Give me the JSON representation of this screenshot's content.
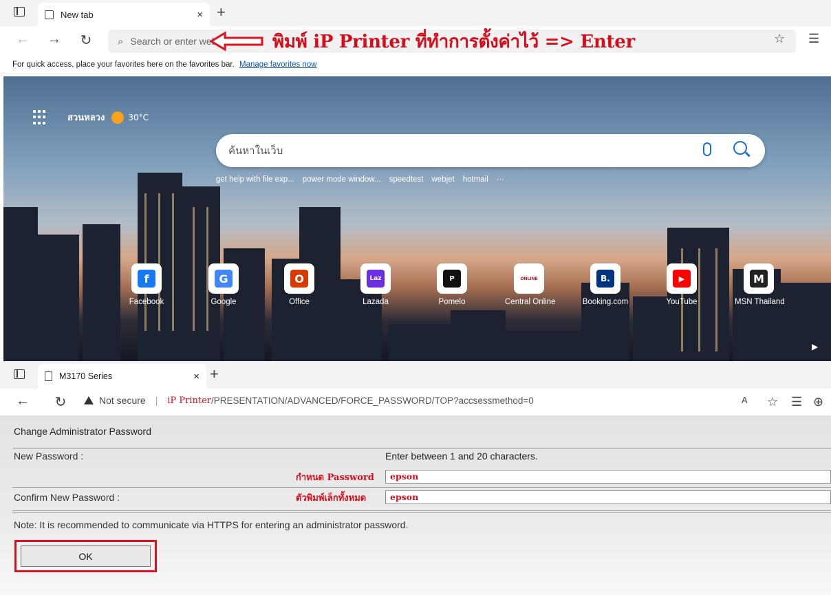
{
  "top_browser": {
    "tab_title": "New tab",
    "tab_close": "×",
    "new_tab": "+",
    "address_placeholder": "Search or enter web address",
    "annotation": "พิมพ์ iP Printer ที่ทำการตั้งค่าไว้ => Enter",
    "favorites_bar_text": "For quick access, place your favorites here on the favorites bar.",
    "favorites_bar_link": "Manage favorites now",
    "weather_location": "สวนหลวง",
    "weather_temp": "30°C",
    "web_search_placeholder": "ค้นหาในเว็บ",
    "suggestions": [
      "get help with file exp...",
      "power mode window...",
      "speedtest",
      "webjet",
      "hotmail",
      "···"
    ],
    "tiles": [
      {
        "label": "Facebook",
        "glyph": "f",
        "color": "#1877f2"
      },
      {
        "label": "Google",
        "glyph": "G",
        "color": "#4285f4"
      },
      {
        "label": "Office",
        "glyph": "O",
        "color": "#d83b01"
      },
      {
        "label": "Lazada",
        "glyph": "Laz",
        "color": "#6a2fe0"
      },
      {
        "label": "Pomelo",
        "glyph": "P",
        "color": "#111111"
      },
      {
        "label": "Central Online",
        "glyph": "ONLINE",
        "color": "#c8102e"
      },
      {
        "label": "Booking.com",
        "glyph": "B.",
        "color": "#003580"
      },
      {
        "label": "YouTube",
        "glyph": "▶",
        "color": "#ff0000"
      },
      {
        "label": "MSN Thailand",
        "glyph": "M",
        "color": "#222222"
      }
    ]
  },
  "bottom_browser": {
    "tab_title": "M3170 Series",
    "tab_close": "×",
    "new_tab": "+",
    "not_secure": "Not secure",
    "url_host": "iP Printer",
    "url_path": "/PRESENTATION/ADVANCED/FORCE_PASSWORD/TOP?accsessmethod=0",
    "page_title": "Change Administrator Password",
    "new_password_label": "New Password :",
    "hint": "Enter between 1 and 20 characters.",
    "note_set_password": "กำหนด Password",
    "new_password_value": "epson",
    "confirm_label": "Confirm New Password :",
    "note_lowercase": "ตัวพิมพ์เล็กทั้งหมด",
    "confirm_value": "epson",
    "https_note": "Note: It is recommended to communicate via HTTPS for entering an administrator password.",
    "ok_label": "OK"
  }
}
